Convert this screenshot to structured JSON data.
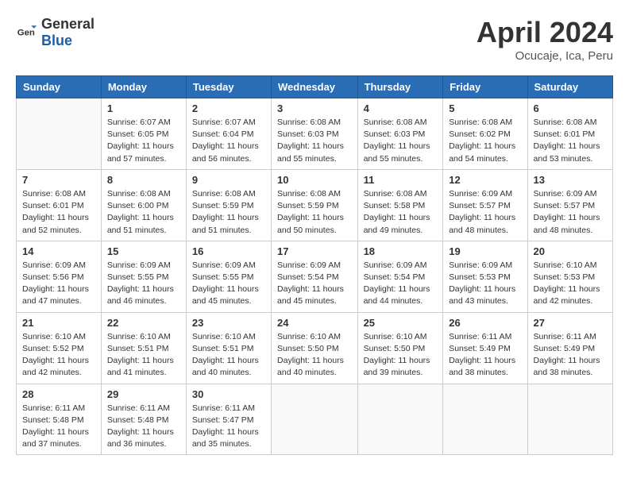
{
  "logo": {
    "general": "General",
    "blue": "Blue"
  },
  "title": "April 2024",
  "location": "Ocucaje, Ica, Peru",
  "header_days": [
    "Sunday",
    "Monday",
    "Tuesday",
    "Wednesday",
    "Thursday",
    "Friday",
    "Saturday"
  ],
  "weeks": [
    [
      {
        "day": "",
        "empty": true
      },
      {
        "day": "1",
        "sunrise": "6:07 AM",
        "sunset": "6:05 PM",
        "daylight": "11 hours and 57 minutes."
      },
      {
        "day": "2",
        "sunrise": "6:07 AM",
        "sunset": "6:04 PM",
        "daylight": "11 hours and 56 minutes."
      },
      {
        "day": "3",
        "sunrise": "6:08 AM",
        "sunset": "6:03 PM",
        "daylight": "11 hours and 55 minutes."
      },
      {
        "day": "4",
        "sunrise": "6:08 AM",
        "sunset": "6:03 PM",
        "daylight": "11 hours and 55 minutes."
      },
      {
        "day": "5",
        "sunrise": "6:08 AM",
        "sunset": "6:02 PM",
        "daylight": "11 hours and 54 minutes."
      },
      {
        "day": "6",
        "sunrise": "6:08 AM",
        "sunset": "6:01 PM",
        "daylight": "11 hours and 53 minutes."
      }
    ],
    [
      {
        "day": "7",
        "sunrise": "6:08 AM",
        "sunset": "6:01 PM",
        "daylight": "11 hours and 52 minutes."
      },
      {
        "day": "8",
        "sunrise": "6:08 AM",
        "sunset": "6:00 PM",
        "daylight": "11 hours and 51 minutes."
      },
      {
        "day": "9",
        "sunrise": "6:08 AM",
        "sunset": "5:59 PM",
        "daylight": "11 hours and 51 minutes."
      },
      {
        "day": "10",
        "sunrise": "6:08 AM",
        "sunset": "5:59 PM",
        "daylight": "11 hours and 50 minutes."
      },
      {
        "day": "11",
        "sunrise": "6:08 AM",
        "sunset": "5:58 PM",
        "daylight": "11 hours and 49 minutes."
      },
      {
        "day": "12",
        "sunrise": "6:09 AM",
        "sunset": "5:57 PM",
        "daylight": "11 hours and 48 minutes."
      },
      {
        "day": "13",
        "sunrise": "6:09 AM",
        "sunset": "5:57 PM",
        "daylight": "11 hours and 48 minutes."
      }
    ],
    [
      {
        "day": "14",
        "sunrise": "6:09 AM",
        "sunset": "5:56 PM",
        "daylight": "11 hours and 47 minutes."
      },
      {
        "day": "15",
        "sunrise": "6:09 AM",
        "sunset": "5:55 PM",
        "daylight": "11 hours and 46 minutes."
      },
      {
        "day": "16",
        "sunrise": "6:09 AM",
        "sunset": "5:55 PM",
        "daylight": "11 hours and 45 minutes."
      },
      {
        "day": "17",
        "sunrise": "6:09 AM",
        "sunset": "5:54 PM",
        "daylight": "11 hours and 45 minutes."
      },
      {
        "day": "18",
        "sunrise": "6:09 AM",
        "sunset": "5:54 PM",
        "daylight": "11 hours and 44 minutes."
      },
      {
        "day": "19",
        "sunrise": "6:09 AM",
        "sunset": "5:53 PM",
        "daylight": "11 hours and 43 minutes."
      },
      {
        "day": "20",
        "sunrise": "6:10 AM",
        "sunset": "5:53 PM",
        "daylight": "11 hours and 42 minutes."
      }
    ],
    [
      {
        "day": "21",
        "sunrise": "6:10 AM",
        "sunset": "5:52 PM",
        "daylight": "11 hours and 42 minutes."
      },
      {
        "day": "22",
        "sunrise": "6:10 AM",
        "sunset": "5:51 PM",
        "daylight": "11 hours and 41 minutes."
      },
      {
        "day": "23",
        "sunrise": "6:10 AM",
        "sunset": "5:51 PM",
        "daylight": "11 hours and 40 minutes."
      },
      {
        "day": "24",
        "sunrise": "6:10 AM",
        "sunset": "5:50 PM",
        "daylight": "11 hours and 40 minutes."
      },
      {
        "day": "25",
        "sunrise": "6:10 AM",
        "sunset": "5:50 PM",
        "daylight": "11 hours and 39 minutes."
      },
      {
        "day": "26",
        "sunrise": "6:11 AM",
        "sunset": "5:49 PM",
        "daylight": "11 hours and 38 minutes."
      },
      {
        "day": "27",
        "sunrise": "6:11 AM",
        "sunset": "5:49 PM",
        "daylight": "11 hours and 38 minutes."
      }
    ],
    [
      {
        "day": "28",
        "sunrise": "6:11 AM",
        "sunset": "5:48 PM",
        "daylight": "11 hours and 37 minutes."
      },
      {
        "day": "29",
        "sunrise": "6:11 AM",
        "sunset": "5:48 PM",
        "daylight": "11 hours and 36 minutes."
      },
      {
        "day": "30",
        "sunrise": "6:11 AM",
        "sunset": "5:47 PM",
        "daylight": "11 hours and 35 minutes."
      },
      {
        "day": "",
        "empty": true
      },
      {
        "day": "",
        "empty": true
      },
      {
        "day": "",
        "empty": true
      },
      {
        "day": "",
        "empty": true
      }
    ]
  ]
}
